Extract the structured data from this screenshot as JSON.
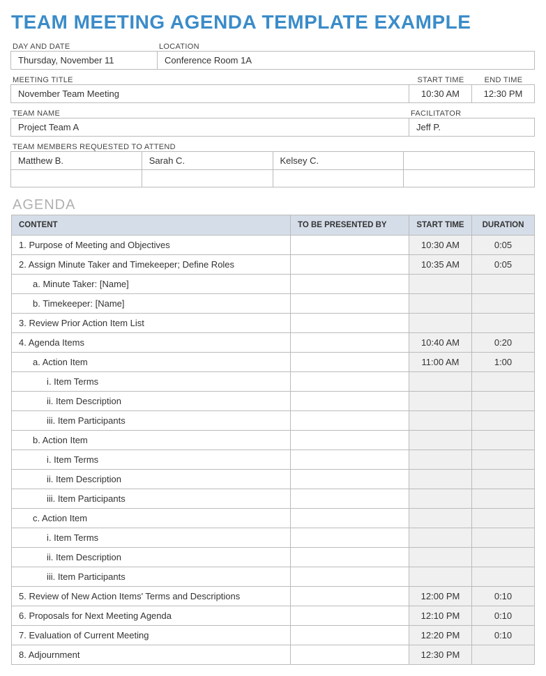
{
  "title": "TEAM MEETING AGENDA TEMPLATE EXAMPLE",
  "labels": {
    "day_date": "DAY AND DATE",
    "location": "LOCATION",
    "meeting_title": "MEETING TITLE",
    "start_time": "START TIME",
    "end_time": "END TIME",
    "team_name": "TEAM NAME",
    "facilitator": "FACILITATOR",
    "members": "TEAM MEMBERS REQUESTED TO ATTEND"
  },
  "info": {
    "day_date": "Thursday, November 11",
    "location": "Conference Room 1A",
    "meeting_title": "November Team Meeting",
    "start_time": "10:30 AM",
    "end_time": "12:30 PM",
    "team_name": "Project Team A",
    "facilitator": "Jeff P."
  },
  "members": [
    "Matthew B.",
    "Sarah C.",
    "Kelsey C.",
    "",
    "",
    "",
    "",
    ""
  ],
  "agenda_heading": "AGENDA",
  "agenda_headers": {
    "content": "CONTENT",
    "presenter": "TO BE PRESENTED BY",
    "start": "START TIME",
    "duration": "DURATION"
  },
  "agenda_rows": [
    {
      "content": "1. Purpose of Meeting and Objectives",
      "indent": 0,
      "presenter": "",
      "start": "10:30 AM",
      "duration": "0:05"
    },
    {
      "content": "2. Assign Minute Taker and Timekeeper; Define Roles",
      "indent": 0,
      "presenter": "",
      "start": "10:35 AM",
      "duration": "0:05"
    },
    {
      "content": "a. Minute Taker: [Name]",
      "indent": 1,
      "presenter": "",
      "start": "",
      "duration": ""
    },
    {
      "content": "b. Timekeeper: [Name]",
      "indent": 1,
      "presenter": "",
      "start": "",
      "duration": ""
    },
    {
      "content": "3. Review Prior Action Item List",
      "indent": 0,
      "presenter": "",
      "start": "",
      "duration": ""
    },
    {
      "content": "4. Agenda Items",
      "indent": 0,
      "presenter": "",
      "start": "10:40 AM",
      "duration": "0:20"
    },
    {
      "content": "a. Action Item",
      "indent": 1,
      "presenter": "",
      "start": "11:00 AM",
      "duration": "1:00"
    },
    {
      "content": "i. Item Terms",
      "indent": 2,
      "presenter": "",
      "start": "",
      "duration": ""
    },
    {
      "content": "ii. Item Description",
      "indent": 2,
      "presenter": "",
      "start": "",
      "duration": ""
    },
    {
      "content": "iii. Item Participants",
      "indent": 2,
      "presenter": "",
      "start": "",
      "duration": ""
    },
    {
      "content": "b. Action Item",
      "indent": 1,
      "presenter": "",
      "start": "",
      "duration": ""
    },
    {
      "content": "i. Item Terms",
      "indent": 2,
      "presenter": "",
      "start": "",
      "duration": ""
    },
    {
      "content": "ii. Item Description",
      "indent": 2,
      "presenter": "",
      "start": "",
      "duration": ""
    },
    {
      "content": "iii. Item Participants",
      "indent": 2,
      "presenter": "",
      "start": "",
      "duration": ""
    },
    {
      "content": "c. Action Item",
      "indent": 1,
      "presenter": "",
      "start": "",
      "duration": ""
    },
    {
      "content": "i. Item Terms",
      "indent": 2,
      "presenter": "",
      "start": "",
      "duration": ""
    },
    {
      "content": "ii. Item Description",
      "indent": 2,
      "presenter": "",
      "start": "",
      "duration": ""
    },
    {
      "content": "iii. Item Participants",
      "indent": 2,
      "presenter": "",
      "start": "",
      "duration": ""
    },
    {
      "content": "5. Review of New Action Items' Terms and Descriptions",
      "indent": 0,
      "presenter": "",
      "start": "12:00 PM",
      "duration": "0:10"
    },
    {
      "content": "6. Proposals for Next Meeting Agenda",
      "indent": 0,
      "presenter": "",
      "start": "12:10 PM",
      "duration": "0:10"
    },
    {
      "content": "7. Evaluation of Current Meeting",
      "indent": 0,
      "presenter": "",
      "start": "12:20 PM",
      "duration": "0:10"
    },
    {
      "content": "8. Adjournment",
      "indent": 0,
      "presenter": "",
      "start": "12:30 PM",
      "duration": ""
    }
  ]
}
